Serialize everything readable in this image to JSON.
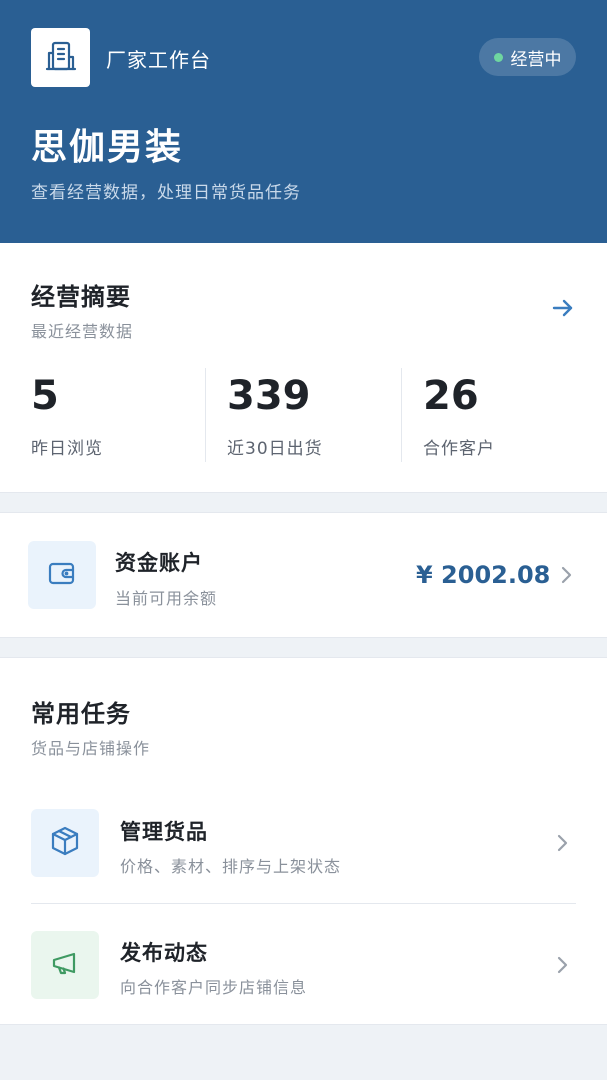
{
  "header": {
    "logo_icon": "building-icon",
    "workbench_label": "厂家工作台",
    "status_label": "经营中",
    "status_color": "#6fd6a0",
    "shop_name": "思伽男装",
    "shop_desc": "查看经营数据，处理日常货品任务",
    "bg_color": "#2a5f93"
  },
  "summary": {
    "title": "经营摘要",
    "subtitle": "最近经营数据",
    "arrow_icon": "arrow-right-icon",
    "stats": [
      {
        "value": "5",
        "label": "昨日浏览"
      },
      {
        "value": "339",
        "label": "近30日出货"
      },
      {
        "value": "26",
        "label": "合作客户"
      }
    ]
  },
  "funds": {
    "icon": "wallet-icon",
    "title": "资金账户",
    "subtitle": "当前可用余额",
    "amount": "¥ 2002.08"
  },
  "tasks": {
    "title": "常用任务",
    "subtitle": "货品与店铺操作",
    "items": [
      {
        "icon": "package-icon",
        "title": "管理货品",
        "subtitle": "价格、素材、排序与上架状态"
      },
      {
        "icon": "megaphone-icon",
        "title": "发布动态",
        "subtitle": "向合作客户同步店铺信息"
      }
    ]
  }
}
